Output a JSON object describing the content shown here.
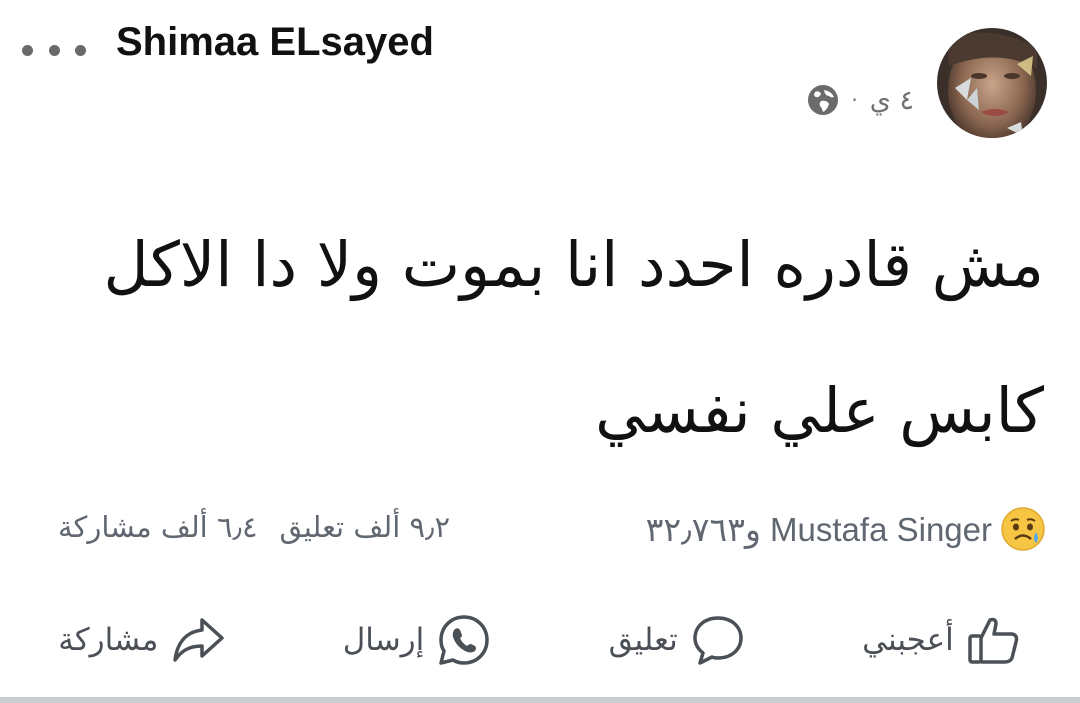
{
  "post": {
    "author_name": "Shimaa ELsayed",
    "time": "٤ ي",
    "separator": "·",
    "privacy_icon": "globe-icon",
    "text_line_1": "مش قادره احدد انا بموت ولا دا الاكل",
    "text_line_2": "كابس علي نفسي"
  },
  "reactions": {
    "emoji_icon": "sad-emoji-icon",
    "summary": "Mustafa Singer و٣٢٫٧٦٣"
  },
  "counts": {
    "comments": "٩٫٢ ألف تعليق",
    "shares": "٦٫٤ ألف مشاركة"
  },
  "actions": {
    "like": "أعجبني",
    "comment": "تعليق",
    "send": "إرسال",
    "share": "مشاركة"
  },
  "colors": {
    "text": "#111111",
    "muted": "#606770",
    "divider": "#c9ccd1"
  }
}
